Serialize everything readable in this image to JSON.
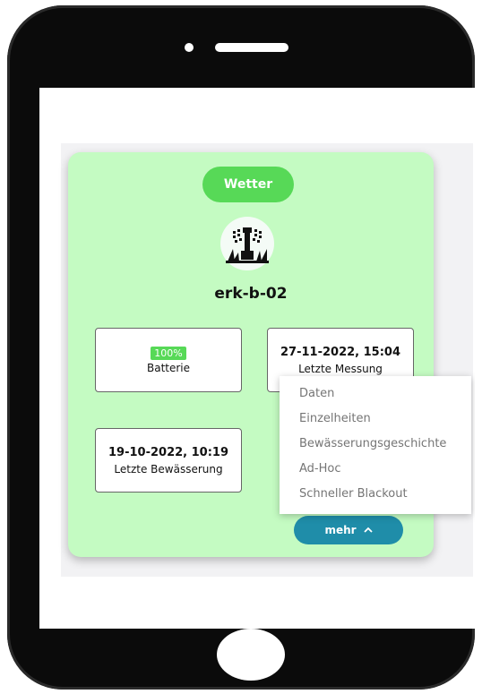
{
  "card": {
    "weather_label": "Wetter",
    "device_name": "erk-b-02"
  },
  "stats": {
    "battery": {
      "value": "100%",
      "label": "Batterie"
    },
    "last_measurement": {
      "value": "27-11-2022, 15:04",
      "label": "Letzte Messung"
    },
    "last_irrigation": {
      "value": "19-10-2022, 10:19",
      "label": "Letzte Bewässerung"
    }
  },
  "menu": {
    "items": [
      "Daten",
      "Einzelheiten",
      "Bewässerungsgeschichte",
      "Ad-Hoc",
      "Schneller Blackout"
    ]
  },
  "more": {
    "label": "mehr",
    "icon": "chevron-up-icon"
  },
  "colors": {
    "card_bg": "#c4fbc2",
    "accent_green": "#57d957",
    "button_blue": "#1f8da9",
    "phone_frame": "#0b0b0b"
  }
}
